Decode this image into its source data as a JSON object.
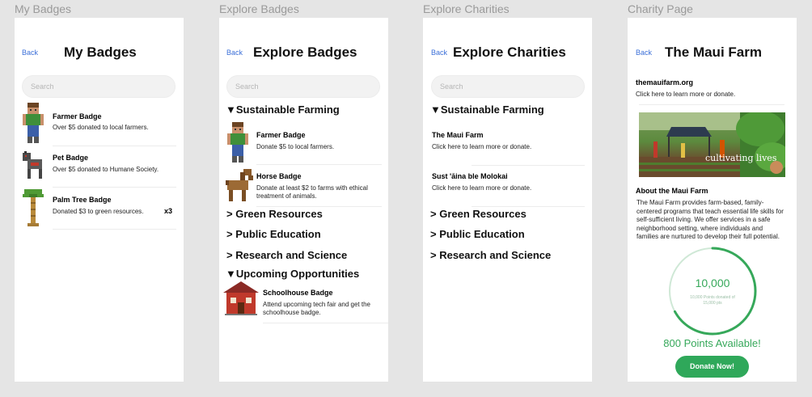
{
  "frames": {
    "my_badges": {
      "label": "My Badges",
      "back": "Back",
      "title": "My Badges",
      "search_placeholder": "Search",
      "items": [
        {
          "name": "Farmer Badge",
          "desc": "Over $5 donated to local farmers.",
          "count": "",
          "icon": "farmer-icon"
        },
        {
          "name": "Pet Badge",
          "desc": "Over $5 donated to Humane Society.",
          "count": "",
          "icon": "dog-icon"
        },
        {
          "name": "Palm Tree Badge",
          "desc": "Donated $3 to green resources.",
          "count": "x3",
          "icon": "palm-tree-icon"
        }
      ]
    },
    "explore_badges": {
      "label": "Explore Badges",
      "back": "Back",
      "title": "Explore Badges",
      "search_placeholder": "Search",
      "cat_sustainable": "▼Sustainable Farming",
      "items": [
        {
          "name": "Farmer Badge",
          "desc": "Donate $5 to local farmers.",
          "icon": "farmer-icon"
        },
        {
          "name": "Horse Badge",
          "desc": "Donate at least $2 to farms with ethical treatment of animals.",
          "icon": "horse-icon"
        }
      ],
      "cat_green": "> Green Resources",
      "cat_public": "> Public Education",
      "cat_research": "> Research and Science",
      "cat_upcoming": "▼Upcoming Opportunities",
      "upcoming_item": {
        "name": "Schoolhouse Badge",
        "desc": "Attend upcoming tech fair and get the schoolhouse badge.",
        "icon": "schoolhouse-icon"
      }
    },
    "explore_charities": {
      "label": "Explore Charities",
      "back": "Back",
      "title": "Explore Charities",
      "search_placeholder": "Search",
      "cat_sustainable": "▼Sustainable Farming",
      "items": [
        {
          "name": "The Maui Farm",
          "desc": "Click here to learn more or donate."
        },
        {
          "name": "Sust 'āina ble Molokai",
          "desc": "Click here to learn more or donate."
        }
      ],
      "cat_green": "> Green Resources",
      "cat_public": "> Public Education",
      "cat_research": "> Research and Science"
    },
    "charity_page": {
      "label": "Charity Page",
      "back": "Back",
      "title": "The Maui Farm",
      "website": "themauifarm.org",
      "website_note": "Click here to learn more or donate.",
      "photo_caption": "cultivating lives",
      "about_heading": "About the Maui Farm",
      "about_text": "The Maui Farm provides farm-based, family-centered programs that teach essential life skills for self-sufficient living. We offer services in a safe neighborhood setting, where individuals and families are nurtured to develop their full potential.",
      "points_value": "10,000",
      "points_sub": "10,000 Points donated of 15,000 pts",
      "progress_fraction": 0.67,
      "points_available": "800 Points Available!",
      "donate_button": "Donate Now!"
    }
  },
  "colors": {
    "accent_green": "#36a85a",
    "donate_button": "#2fa85a",
    "link_blue": "#3b6fd8",
    "ring_light": "#cfe8d6"
  }
}
